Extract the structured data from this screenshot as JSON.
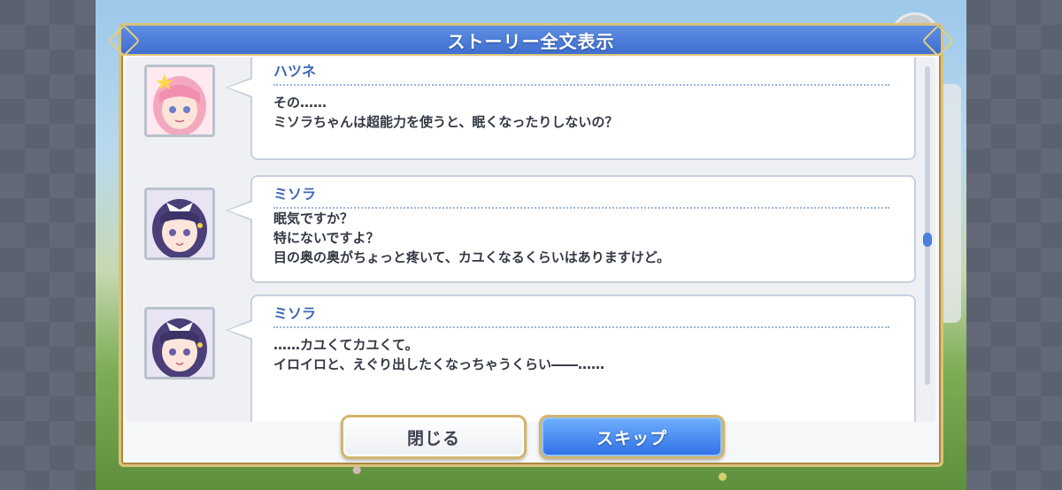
{
  "dialog": {
    "title": "ストーリー全文表示"
  },
  "entries": [
    {
      "speaker": "ハツネ",
      "avatar_icon": "pink-hair-girl-portrait-icon",
      "lines": [
        "その……",
        "ミソラちゃんは超能力を使うと、眠くなったりしないの？"
      ]
    },
    {
      "speaker": "ミソラ",
      "avatar_icon": "purple-hair-girl-portrait-icon",
      "lines": [
        "眠気ですか？",
        "特にないですよ？",
        "目の奥の奥がちょっと疼いて、カユくなるくらいはありますけど。"
      ]
    },
    {
      "speaker": "ミソラ",
      "avatar_icon": "purple-hair-girl-portrait-icon",
      "lines": [
        "……カユくてカユくて。",
        "イロイロと、えぐり出したくなっちゃうくらい――……"
      ]
    }
  ],
  "buttons": {
    "close_label": "閉じる",
    "skip_label": "スキップ"
  },
  "colors": {
    "header_blue": "#4a7ad8",
    "skip_blue": "#2f6fe6",
    "gold_border": "#d9c27a",
    "speaker_text": "#3c66b8"
  }
}
